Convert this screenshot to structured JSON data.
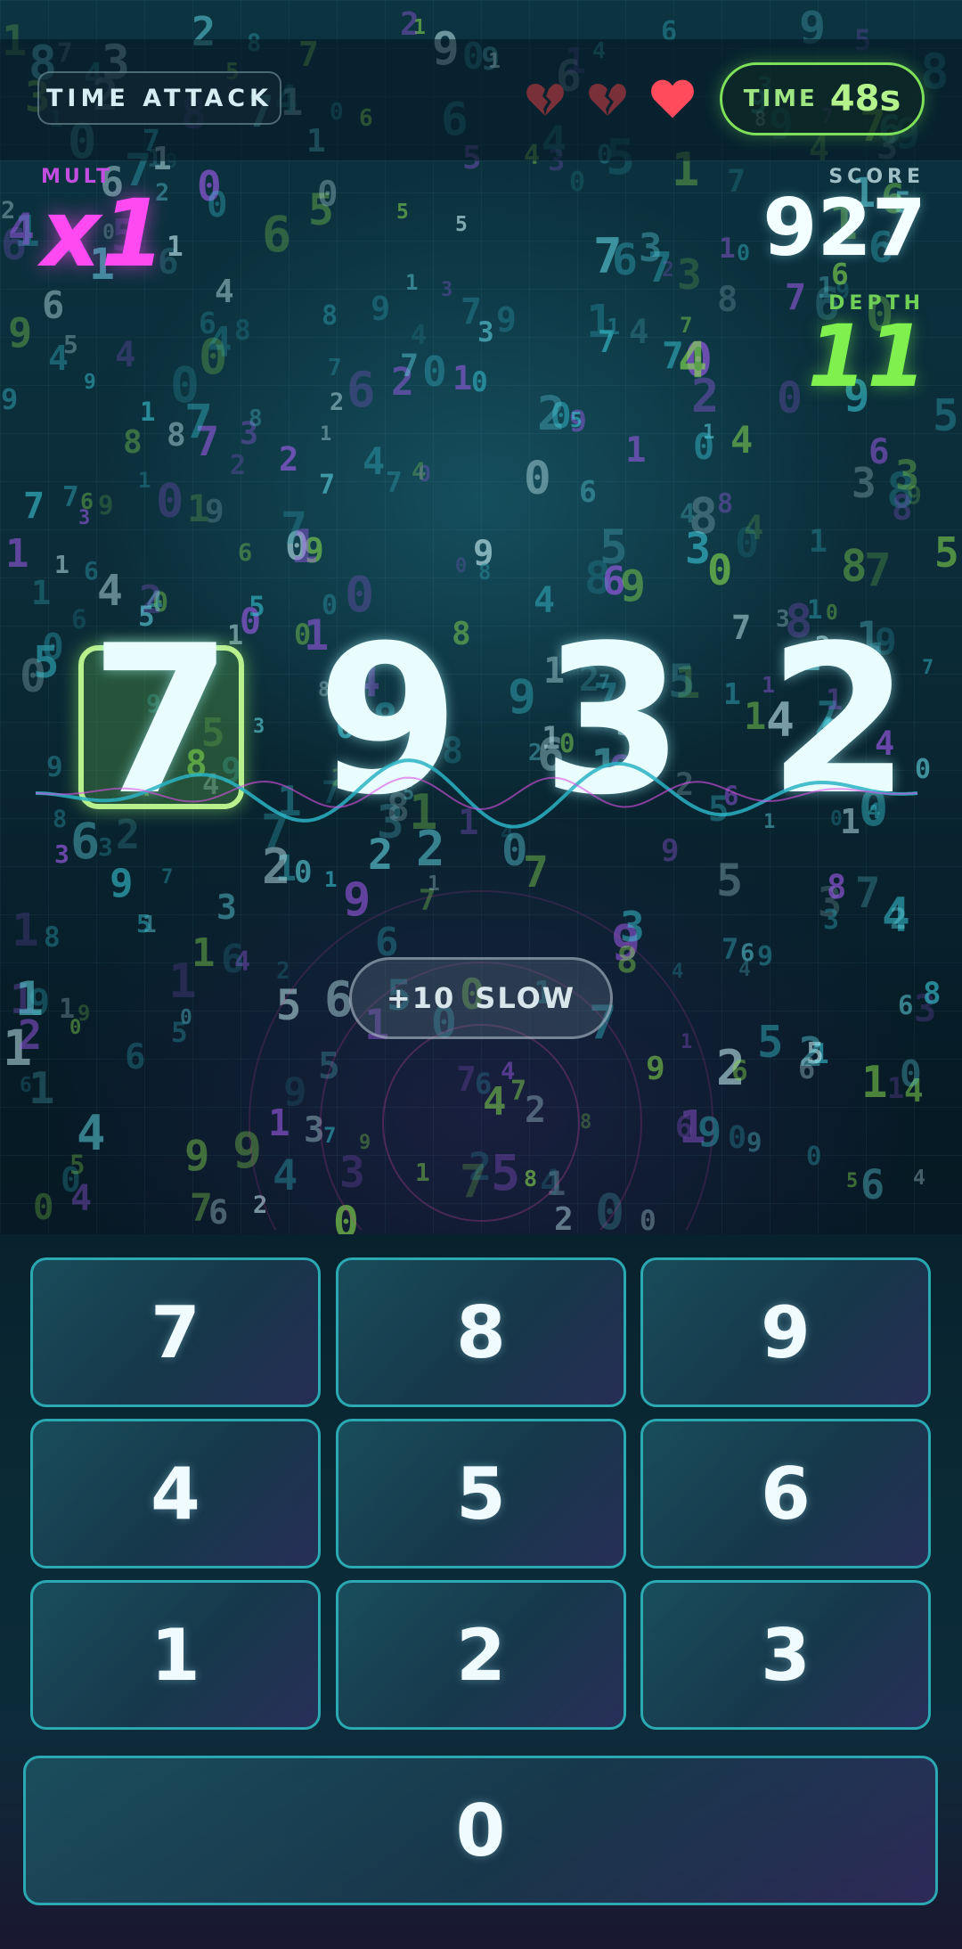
{
  "header": {
    "mode": "TIME ATTACK",
    "time_label": "TIME",
    "time_value": "48s",
    "lives": {
      "total": 3,
      "remaining": 1
    }
  },
  "stats": {
    "mult_label": "MULT",
    "mult_value": "x1",
    "score_label": "SCORE",
    "score_value": "927",
    "depth_label": "DEPTH",
    "depth_value": "11"
  },
  "sequence": {
    "digits": [
      "7",
      "9",
      "3",
      "2"
    ],
    "active_index": 0
  },
  "powerup": {
    "cost": "+10",
    "label": "SLOW"
  },
  "keypad": {
    "keys": [
      "7",
      "8",
      "9",
      "4",
      "5",
      "6",
      "1",
      "2",
      "3",
      "0"
    ]
  },
  "colors": {
    "accent_green": "#7ff04e",
    "accent_magenta": "#ff4af2",
    "key_border": "#2aa9b3",
    "heart_full": "#ff4b5c",
    "heart_broken": "#7a3038"
  }
}
